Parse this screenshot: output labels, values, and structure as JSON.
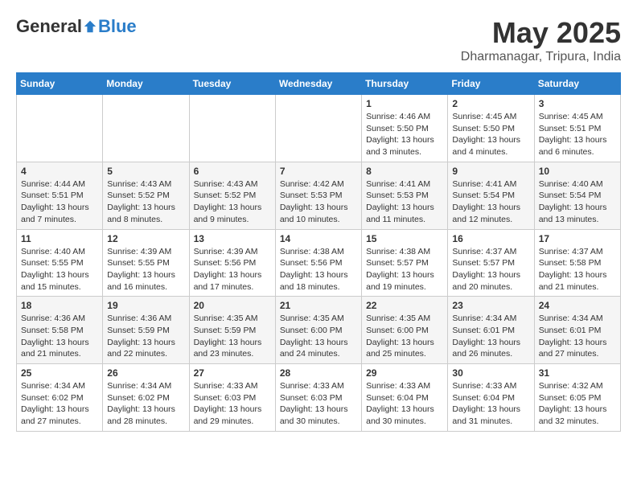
{
  "header": {
    "logo": {
      "text_general": "General",
      "text_blue": "Blue"
    },
    "title": "May 2025",
    "location": "Dharmanagar, Tripura, India"
  },
  "weekdays": [
    "Sunday",
    "Monday",
    "Tuesday",
    "Wednesday",
    "Thursday",
    "Friday",
    "Saturday"
  ],
  "weeks": [
    [
      {
        "day": "",
        "sunrise": "",
        "sunset": "",
        "daylight": ""
      },
      {
        "day": "",
        "sunrise": "",
        "sunset": "",
        "daylight": ""
      },
      {
        "day": "",
        "sunrise": "",
        "sunset": "",
        "daylight": ""
      },
      {
        "day": "",
        "sunrise": "",
        "sunset": "",
        "daylight": ""
      },
      {
        "day": "1",
        "sunrise": "Sunrise: 4:46 AM",
        "sunset": "Sunset: 5:50 PM",
        "daylight": "Daylight: 13 hours and 3 minutes."
      },
      {
        "day": "2",
        "sunrise": "Sunrise: 4:45 AM",
        "sunset": "Sunset: 5:50 PM",
        "daylight": "Daylight: 13 hours and 4 minutes."
      },
      {
        "day": "3",
        "sunrise": "Sunrise: 4:45 AM",
        "sunset": "Sunset: 5:51 PM",
        "daylight": "Daylight: 13 hours and 6 minutes."
      }
    ],
    [
      {
        "day": "4",
        "sunrise": "Sunrise: 4:44 AM",
        "sunset": "Sunset: 5:51 PM",
        "daylight": "Daylight: 13 hours and 7 minutes."
      },
      {
        "day": "5",
        "sunrise": "Sunrise: 4:43 AM",
        "sunset": "Sunset: 5:52 PM",
        "daylight": "Daylight: 13 hours and 8 minutes."
      },
      {
        "day": "6",
        "sunrise": "Sunrise: 4:43 AM",
        "sunset": "Sunset: 5:52 PM",
        "daylight": "Daylight: 13 hours and 9 minutes."
      },
      {
        "day": "7",
        "sunrise": "Sunrise: 4:42 AM",
        "sunset": "Sunset: 5:53 PM",
        "daylight": "Daylight: 13 hours and 10 minutes."
      },
      {
        "day": "8",
        "sunrise": "Sunrise: 4:41 AM",
        "sunset": "Sunset: 5:53 PM",
        "daylight": "Daylight: 13 hours and 11 minutes."
      },
      {
        "day": "9",
        "sunrise": "Sunrise: 4:41 AM",
        "sunset": "Sunset: 5:54 PM",
        "daylight": "Daylight: 13 hours and 12 minutes."
      },
      {
        "day": "10",
        "sunrise": "Sunrise: 4:40 AM",
        "sunset": "Sunset: 5:54 PM",
        "daylight": "Daylight: 13 hours and 13 minutes."
      }
    ],
    [
      {
        "day": "11",
        "sunrise": "Sunrise: 4:40 AM",
        "sunset": "Sunset: 5:55 PM",
        "daylight": "Daylight: 13 hours and 15 minutes."
      },
      {
        "day": "12",
        "sunrise": "Sunrise: 4:39 AM",
        "sunset": "Sunset: 5:55 PM",
        "daylight": "Daylight: 13 hours and 16 minutes."
      },
      {
        "day": "13",
        "sunrise": "Sunrise: 4:39 AM",
        "sunset": "Sunset: 5:56 PM",
        "daylight": "Daylight: 13 hours and 17 minutes."
      },
      {
        "day": "14",
        "sunrise": "Sunrise: 4:38 AM",
        "sunset": "Sunset: 5:56 PM",
        "daylight": "Daylight: 13 hours and 18 minutes."
      },
      {
        "day": "15",
        "sunrise": "Sunrise: 4:38 AM",
        "sunset": "Sunset: 5:57 PM",
        "daylight": "Daylight: 13 hours and 19 minutes."
      },
      {
        "day": "16",
        "sunrise": "Sunrise: 4:37 AM",
        "sunset": "Sunset: 5:57 PM",
        "daylight": "Daylight: 13 hours and 20 minutes."
      },
      {
        "day": "17",
        "sunrise": "Sunrise: 4:37 AM",
        "sunset": "Sunset: 5:58 PM",
        "daylight": "Daylight: 13 hours and 21 minutes."
      }
    ],
    [
      {
        "day": "18",
        "sunrise": "Sunrise: 4:36 AM",
        "sunset": "Sunset: 5:58 PM",
        "daylight": "Daylight: 13 hours and 21 minutes."
      },
      {
        "day": "19",
        "sunrise": "Sunrise: 4:36 AM",
        "sunset": "Sunset: 5:59 PM",
        "daylight": "Daylight: 13 hours and 22 minutes."
      },
      {
        "day": "20",
        "sunrise": "Sunrise: 4:35 AM",
        "sunset": "Sunset: 5:59 PM",
        "daylight": "Daylight: 13 hours and 23 minutes."
      },
      {
        "day": "21",
        "sunrise": "Sunrise: 4:35 AM",
        "sunset": "Sunset: 6:00 PM",
        "daylight": "Daylight: 13 hours and 24 minutes."
      },
      {
        "day": "22",
        "sunrise": "Sunrise: 4:35 AM",
        "sunset": "Sunset: 6:00 PM",
        "daylight": "Daylight: 13 hours and 25 minutes."
      },
      {
        "day": "23",
        "sunrise": "Sunrise: 4:34 AM",
        "sunset": "Sunset: 6:01 PM",
        "daylight": "Daylight: 13 hours and 26 minutes."
      },
      {
        "day": "24",
        "sunrise": "Sunrise: 4:34 AM",
        "sunset": "Sunset: 6:01 PM",
        "daylight": "Daylight: 13 hours and 27 minutes."
      }
    ],
    [
      {
        "day": "25",
        "sunrise": "Sunrise: 4:34 AM",
        "sunset": "Sunset: 6:02 PM",
        "daylight": "Daylight: 13 hours and 27 minutes."
      },
      {
        "day": "26",
        "sunrise": "Sunrise: 4:34 AM",
        "sunset": "Sunset: 6:02 PM",
        "daylight": "Daylight: 13 hours and 28 minutes."
      },
      {
        "day": "27",
        "sunrise": "Sunrise: 4:33 AM",
        "sunset": "Sunset: 6:03 PM",
        "daylight": "Daylight: 13 hours and 29 minutes."
      },
      {
        "day": "28",
        "sunrise": "Sunrise: 4:33 AM",
        "sunset": "Sunset: 6:03 PM",
        "daylight": "Daylight: 13 hours and 30 minutes."
      },
      {
        "day": "29",
        "sunrise": "Sunrise: 4:33 AM",
        "sunset": "Sunset: 6:04 PM",
        "daylight": "Daylight: 13 hours and 30 minutes."
      },
      {
        "day": "30",
        "sunrise": "Sunrise: 4:33 AM",
        "sunset": "Sunset: 6:04 PM",
        "daylight": "Daylight: 13 hours and 31 minutes."
      },
      {
        "day": "31",
        "sunrise": "Sunrise: 4:32 AM",
        "sunset": "Sunset: 6:05 PM",
        "daylight": "Daylight: 13 hours and 32 minutes."
      }
    ]
  ]
}
